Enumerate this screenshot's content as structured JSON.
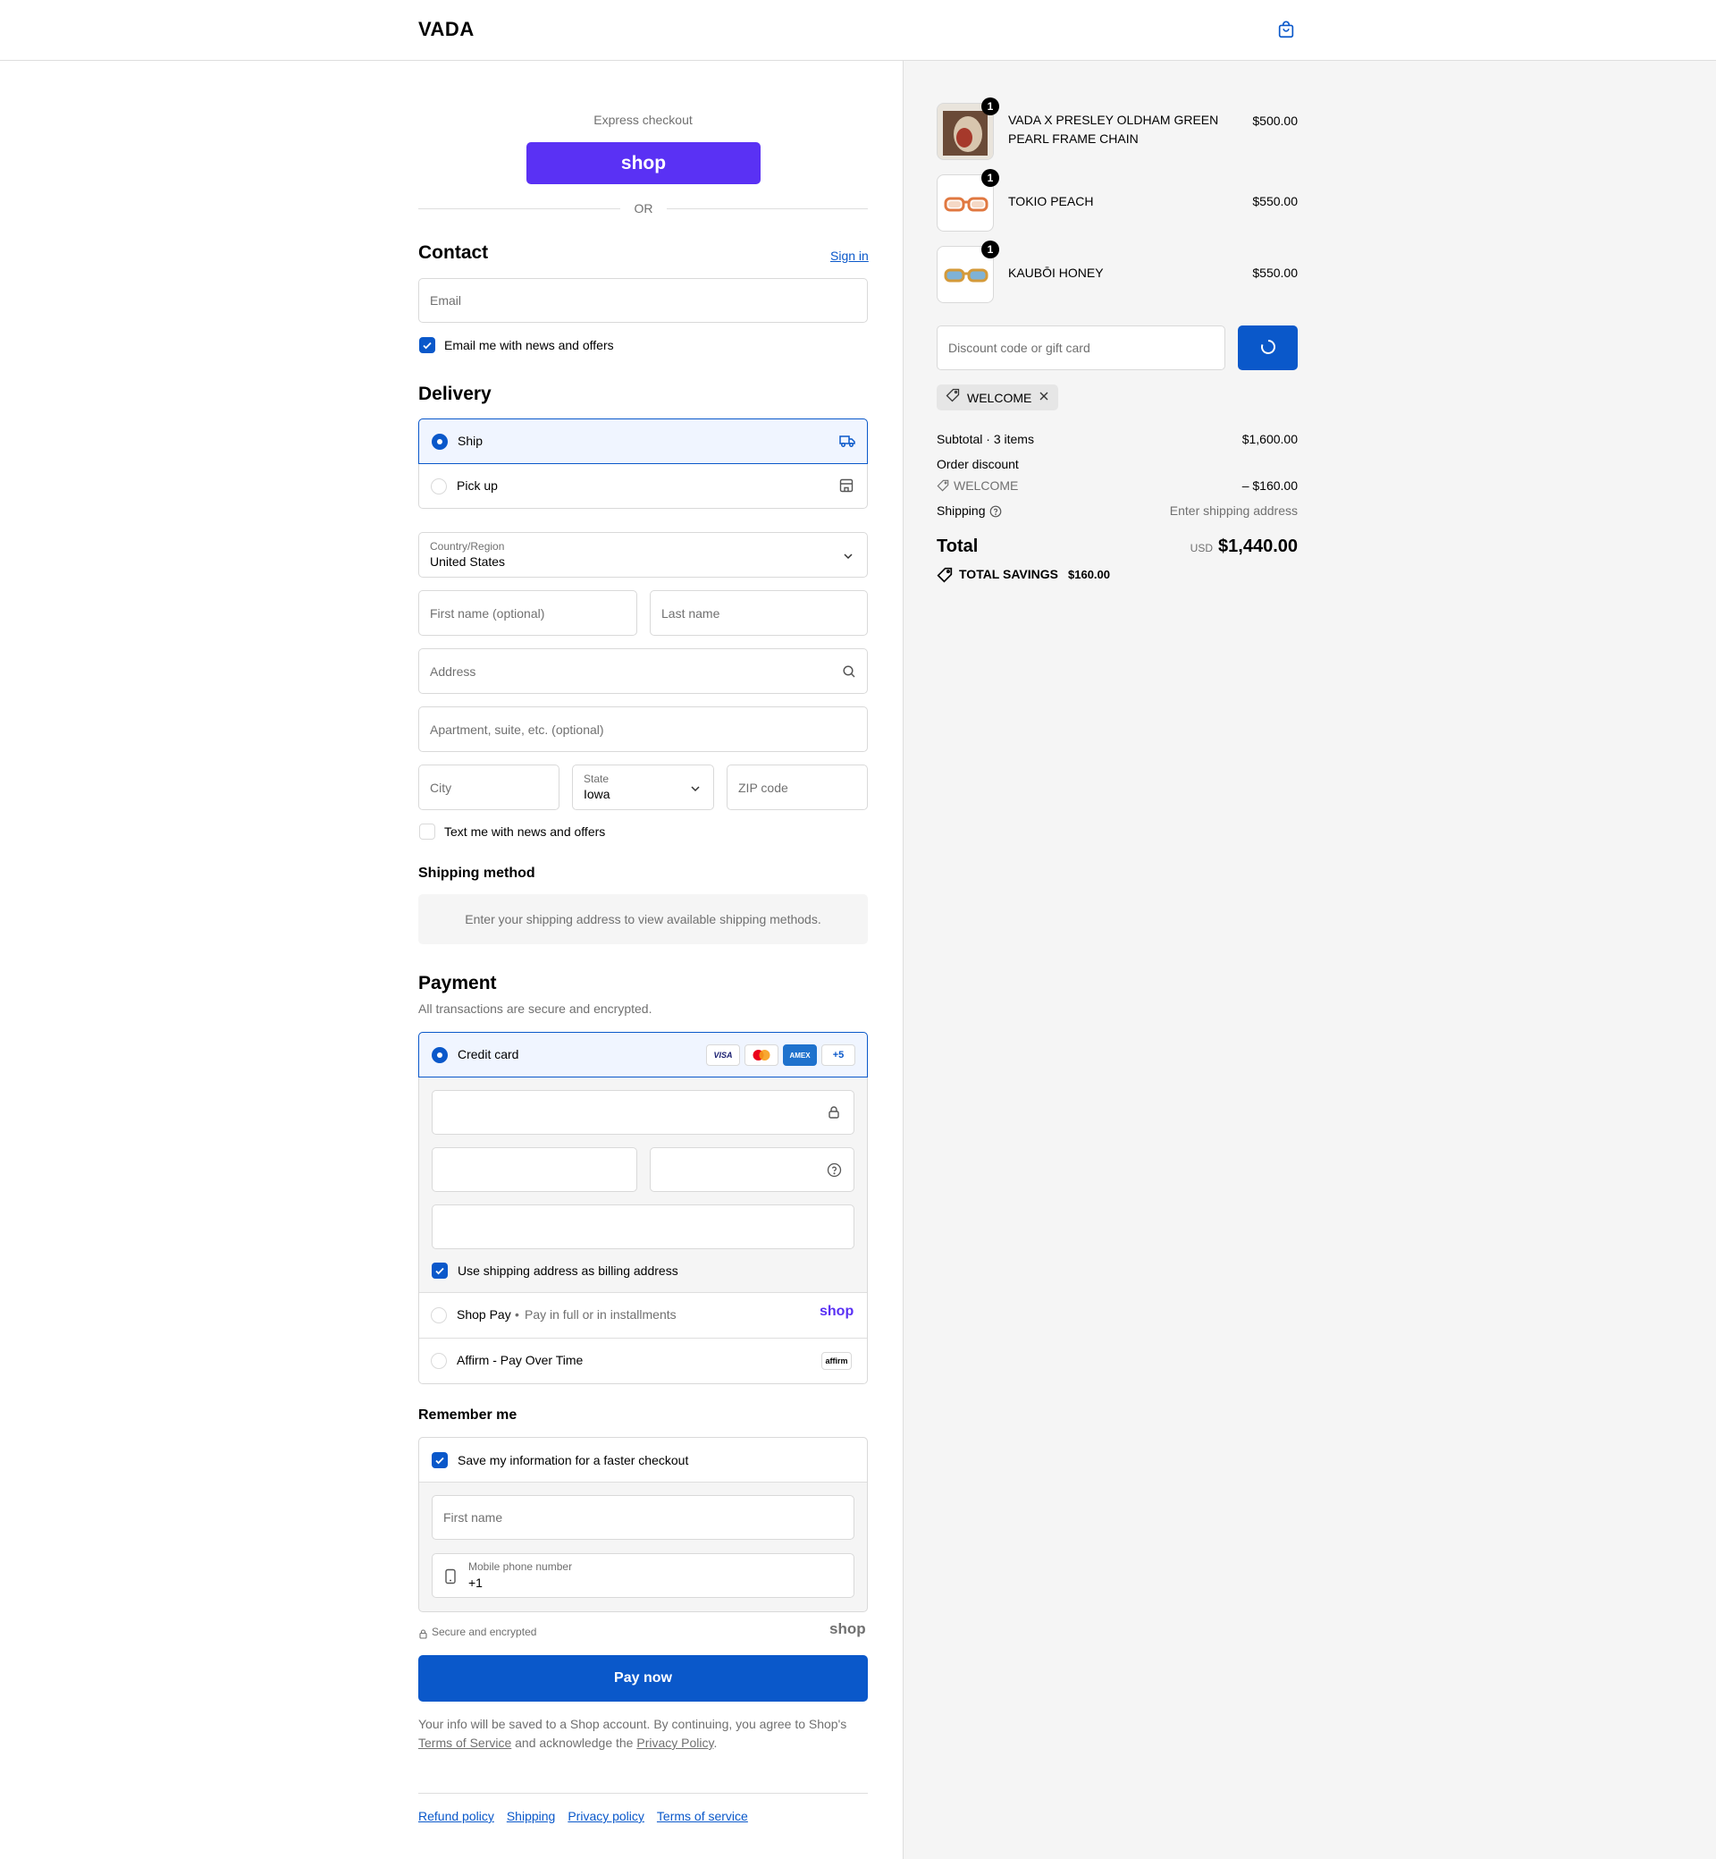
{
  "header": {
    "logo": "VADA",
    "cart_icon": "shopping-bag-icon"
  },
  "express": {
    "label": "Express checkout",
    "shop_pay_label": "shop",
    "or": "OR"
  },
  "contact": {
    "title": "Contact",
    "sign_in": "Sign in",
    "email_placeholder": "Email",
    "news_label": "Email me with news and offers",
    "news_checked": true
  },
  "delivery": {
    "title": "Delivery",
    "ship_label": "Ship",
    "pickup_label": "Pick up",
    "country_label": "Country/Region",
    "country_value": "United States",
    "first_name_placeholder": "First name (optional)",
    "last_name_placeholder": "Last name",
    "address_placeholder": "Address",
    "apartment_placeholder": "Apartment, suite, etc. (optional)",
    "city_placeholder": "City",
    "state_label": "State",
    "state_value": "Iowa",
    "zip_placeholder": "ZIP code",
    "text_news_label": "Text me with news and offers",
    "text_news_checked": false
  },
  "shipping_method": {
    "title": "Shipping method",
    "message": "Enter your shipping address to view available shipping methods."
  },
  "payment": {
    "title": "Payment",
    "subtitle": "All transactions are secure and encrypted.",
    "credit_card_label": "Credit card",
    "card_brands": [
      "VISA",
      "MC",
      "AMEX",
      "+5"
    ],
    "billing_label": "Use shipping address as billing address",
    "billing_checked": true,
    "shop_pay_label": "Shop Pay",
    "shop_pay_sub": "Pay in full or in installments",
    "shop_pay_logo": "shop",
    "affirm_label": "Affirm - Pay Over Time",
    "affirm_logo": "affirm"
  },
  "remember": {
    "title": "Remember me",
    "save_label": "Save my information for a faster checkout",
    "save_checked": true,
    "first_name_placeholder": "First name",
    "phone_label": "Mobile phone number",
    "phone_value": "+1",
    "secure_label": "Secure and encrypted",
    "shop_logo": "shop"
  },
  "pay_button": "Pay now",
  "legal": {
    "text_before": "Your info will be saved to a Shop account. By continuing, you agree to Shop's",
    "tos": "Terms of Service",
    "text_middle": "and acknowledge the",
    "privacy": "Privacy Policy",
    "text_end": "."
  },
  "footer_links": [
    "Refund policy",
    "Shipping",
    "Privacy policy",
    "Terms of service"
  ],
  "cart": {
    "items": [
      {
        "name": "VADA X PRESLEY OLDHAM GREEN PEARL FRAME CHAIN",
        "qty": "1",
        "price": "$500.00"
      },
      {
        "name": "TOKIO PEACH",
        "qty": "1",
        "price": "$550.00"
      },
      {
        "name": "KAUBŌI HONEY",
        "qty": "1",
        "price": "$550.00"
      }
    ],
    "discount_placeholder": "Discount code or gift card",
    "applied_code": "WELCOME",
    "subtotal_label": "Subtotal · 3 items",
    "subtotal_value": "$1,600.00",
    "order_discount_label": "Order discount",
    "discount_code": "WELCOME",
    "discount_value": "– $160.00",
    "shipping_label": "Shipping",
    "shipping_value": "Enter shipping address",
    "total_label": "Total",
    "currency": "USD",
    "total_value": "$1,440.00",
    "savings_label": "TOTAL SAVINGS",
    "savings_value": "$160.00"
  },
  "colors": {
    "accent": "#0a58ca",
    "shop_purple": "#5a31f4"
  }
}
